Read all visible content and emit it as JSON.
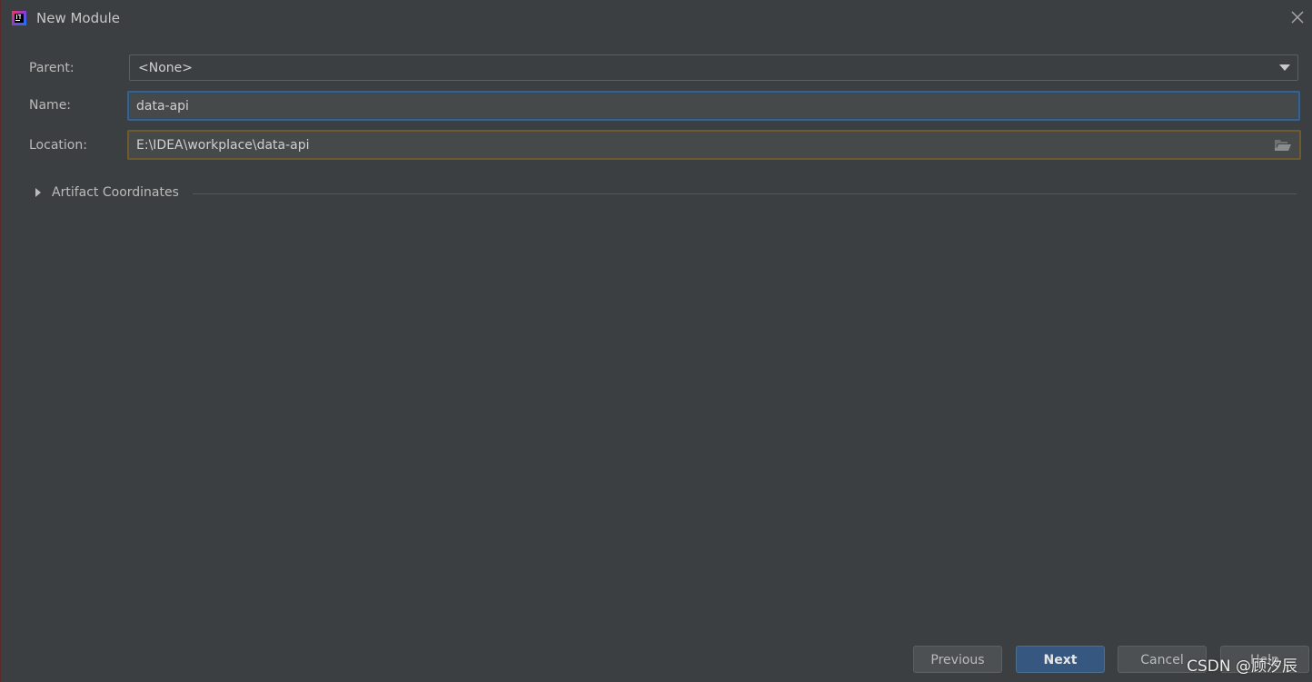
{
  "window": {
    "title": "New Module"
  },
  "form": {
    "parent_label": "Parent:",
    "parent_value": "<None>",
    "name_label": "Name:",
    "name_value": "data-api",
    "location_label": "Location:",
    "location_value": "E:\\IDEA\\workplace\\data-api"
  },
  "section": {
    "artifact_label": "Artifact Coordinates"
  },
  "buttons": {
    "previous": "Previous",
    "next": "Next",
    "cancel": "Cancel",
    "help": "Help"
  },
  "watermark": "CSDN @顾汐辰",
  "colors": {
    "background": "#3c3f41",
    "focus_border": "#3d6185",
    "warning_border": "#6e5a2e",
    "primary_button": "#365880"
  },
  "icons": {
    "app": "intellij-idea-icon",
    "close": "close-icon",
    "dropdown": "chevron-down-icon",
    "browse": "folder-open-icon",
    "expand": "triangle-right-icon"
  }
}
